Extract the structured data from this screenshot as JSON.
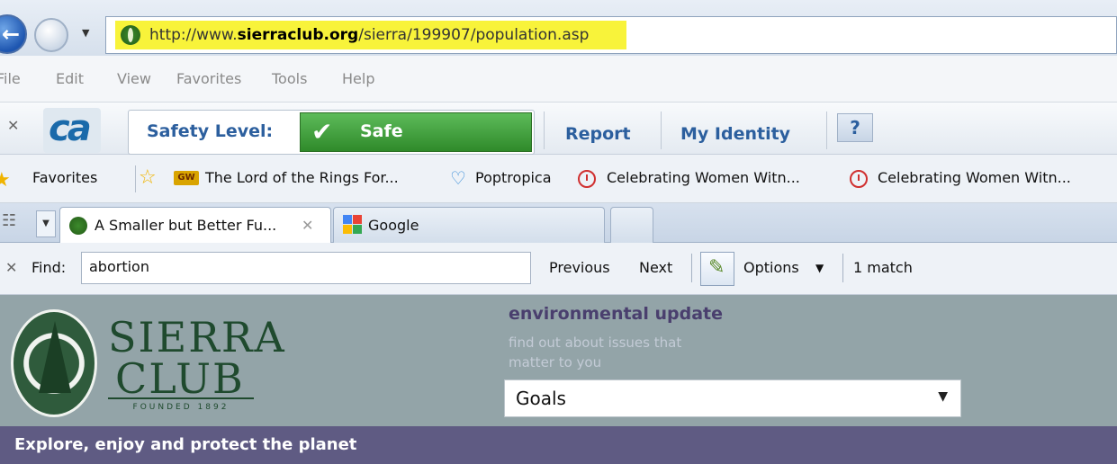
{
  "browser": {
    "address": {
      "url_prefix": "http://www.",
      "url_domain": "sierraclub.org",
      "url_path": "/sierra/199907/population.asp"
    },
    "menu": [
      "File",
      "Edit",
      "View",
      "Favorites",
      "Tools",
      "Help"
    ],
    "ca_toolbar": {
      "logo": "ca",
      "safety_label": "Safety Level:",
      "safety_value": "Safe",
      "report": "Report",
      "my_identity": "My Identity",
      "help": "?"
    },
    "favorites_bar": {
      "favorites_label": "Favorites",
      "gw_badge": "GW",
      "items": [
        "The Lord of the Rings For...",
        "Poptropica",
        "Celebrating Women Witn...",
        "Celebrating Women Witn..."
      ]
    },
    "tabs": [
      {
        "title": "A Smaller but Better Fu...",
        "active": true
      },
      {
        "title": "Google",
        "active": false
      }
    ],
    "find_bar": {
      "label": "Find:",
      "query": "abortion",
      "previous": "Previous",
      "next": "Next",
      "options": "Options",
      "match_count": "1 match"
    }
  },
  "page": {
    "logo": {
      "line1": "SIERRA",
      "line2": "CLUB",
      "founded": "FOUNDED 1892"
    },
    "env_update": {
      "title": "environmental update",
      "subtitle_line1": "find out about issues that",
      "subtitle_line2": "matter to you"
    },
    "goals_select": "Goals",
    "tagline": "Explore, enjoy and protect the planet"
  },
  "colors": {
    "url_highlight": "#f8f33a",
    "safe_green": "#3c9a36",
    "toolbar_blue": "#2c5f9e",
    "page_bg": "#93a4a8",
    "tagline_bar": "#5f5b83",
    "sierra_green": "#1f4a2e"
  }
}
